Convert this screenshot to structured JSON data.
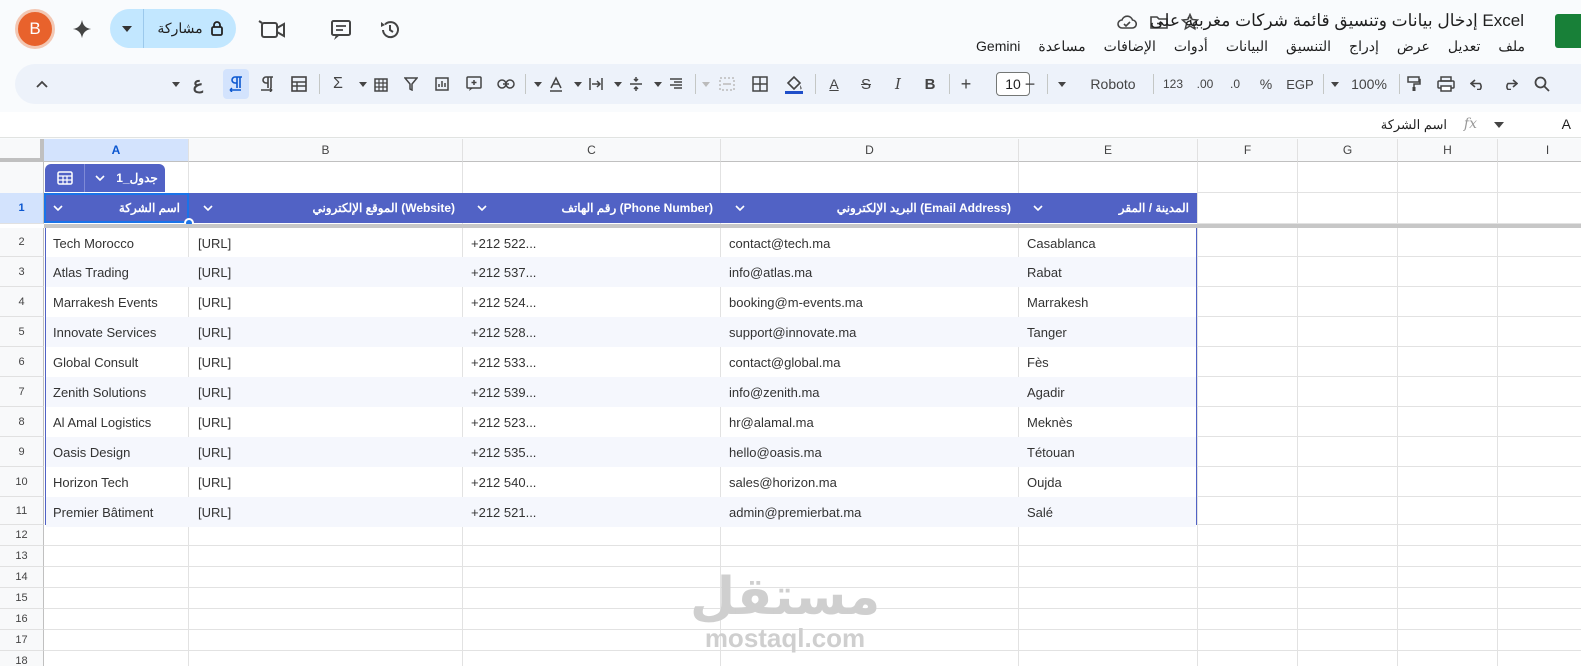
{
  "app": {
    "title": "إدخال بيانات وتنسيق قائمة شركات مغربية على Excel",
    "avatar_letter": "B",
    "share_label": "مشاركة",
    "menus": [
      "ملف",
      "تعديل",
      "عرض",
      "إدراج",
      "التنسيق",
      "البيانات",
      "أدوات",
      "الإضافات",
      "مساعدة",
      "Gemini"
    ]
  },
  "toolbar": {
    "zoom": "100%",
    "currency": "EGP",
    "percent": "%",
    "dec_decrease": ".0",
    "dec_increase": ".00",
    "num_format": "123",
    "font": "Roboto",
    "font_size": "10",
    "bold": "B",
    "italic": "I",
    "strike": "S",
    "text_color": "A",
    "ain": "ع"
  },
  "formula_bar": {
    "cell_ref": "A",
    "fx": "fx",
    "value": "اسم الشركة"
  },
  "columns": [
    "A",
    "B",
    "C",
    "D",
    "E",
    "F",
    "G",
    "H",
    "I"
  ],
  "rows": [
    "1",
    "2",
    "3",
    "4",
    "5",
    "6",
    "7",
    "8",
    "9",
    "10",
    "11",
    "12",
    "13",
    "14",
    "15",
    "16",
    "17",
    "18"
  ],
  "table": {
    "name": "جدول_1",
    "headers": [
      "اسم الشركة",
      "الموقع الإلكتروني (Website)",
      "رقم الهاتف (Phone Number)",
      "البريد الإلكتروني (Email Address)",
      "المدينة / المقر"
    ],
    "rows": [
      [
        "Tech Morocco",
        "[URL]",
        "+212 522...",
        "contact@tech.ma",
        "Casablanca"
      ],
      [
        "Atlas Trading",
        "[URL]",
        "+212 537...",
        "info@atlas.ma",
        "Rabat"
      ],
      [
        "Marrakesh Events",
        "[URL]",
        "+212 524...",
        "booking@m-events.ma",
        "Marrakesh"
      ],
      [
        "Innovate Services",
        "[URL]",
        "+212 528...",
        "support@innovate.ma",
        "Tanger"
      ],
      [
        "Global Consult",
        "[URL]",
        "+212 533...",
        "contact@global.ma",
        "Fès"
      ],
      [
        "Zenith Solutions",
        "[URL]",
        "+212 539...",
        "info@zenith.ma",
        "Agadir"
      ],
      [
        "Al Amal Logistics",
        "[URL]",
        "+212 523...",
        "hr@alamal.ma",
        "Meknès"
      ],
      [
        "Oasis Design",
        "[URL]",
        "+212 535...",
        "hello@oasis.ma",
        "Tétouan"
      ],
      [
        "Horizon Tech",
        "[URL]",
        "+212 540...",
        "sales@horizon.ma",
        "Oujda"
      ],
      [
        "Premier Bâtiment",
        "[URL]",
        "+212 521...",
        "admin@premierbat.ma",
        "Salé"
      ]
    ]
  },
  "watermark": {
    "arabic": "مستقل",
    "latin": "mostaql.com"
  },
  "colors": {
    "accent": "#5162c5",
    "share": "#c2e7ff",
    "avatar": "#e8622c",
    "sheets": "#188038"
  }
}
